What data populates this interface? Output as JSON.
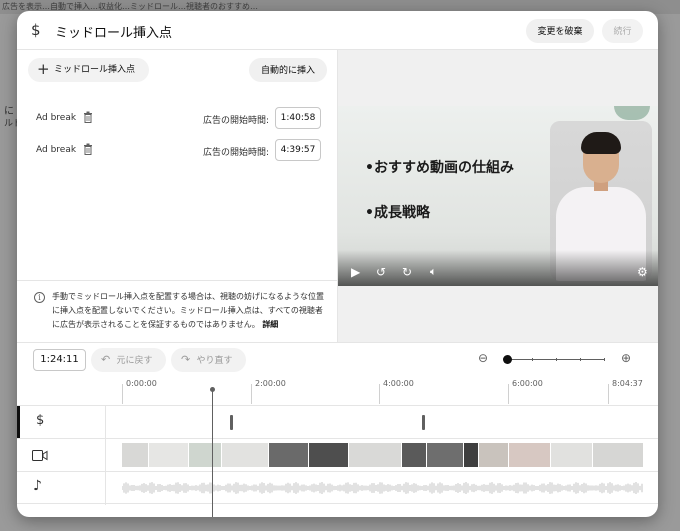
{
  "background": {
    "top_text": "広告を表示…自動で挿入…収益化…ミッドロール…視聴者のおすすめ…",
    "side_label_1": "に",
    "side_label_2": "ルド"
  },
  "dialog": {
    "title": "ミッドロール挿入点",
    "discard_label": "変更を破棄",
    "continue_label": "続行"
  },
  "left_panel": {
    "add_button_label": "ミッドロール挿入点",
    "auto_insert_label": "自動的に挿入",
    "ad_breaks": [
      {
        "label": "Ad break",
        "time_label": "広告の開始時間:",
        "time": "1:40:58"
      },
      {
        "label": "Ad break",
        "time_label": "広告の開始時間:",
        "time": "4:39:57"
      }
    ],
    "info_text": "手動でミッドロール挿入点を配置する場合は、視聴の妨げになるような位置に挿入点を配置しないでください。ミッドロール挿入点は、すべての視聴者に広告が表示されることを保証するものではありません。",
    "info_link": "詳細"
  },
  "preview": {
    "bullet_1": "•おすすめ動画の仕組み",
    "bullet_2": "•成長戦略"
  },
  "toolbar": {
    "current_time": "1:24:11",
    "undo_label": "元に戻す",
    "redo_label": "やり直す",
    "zoom_level": 0
  },
  "timeline": {
    "ruler_labels": [
      "0:00:00",
      "2:00:00",
      "4:00:00",
      "6:00:00",
      "8:04:37"
    ]
  }
}
